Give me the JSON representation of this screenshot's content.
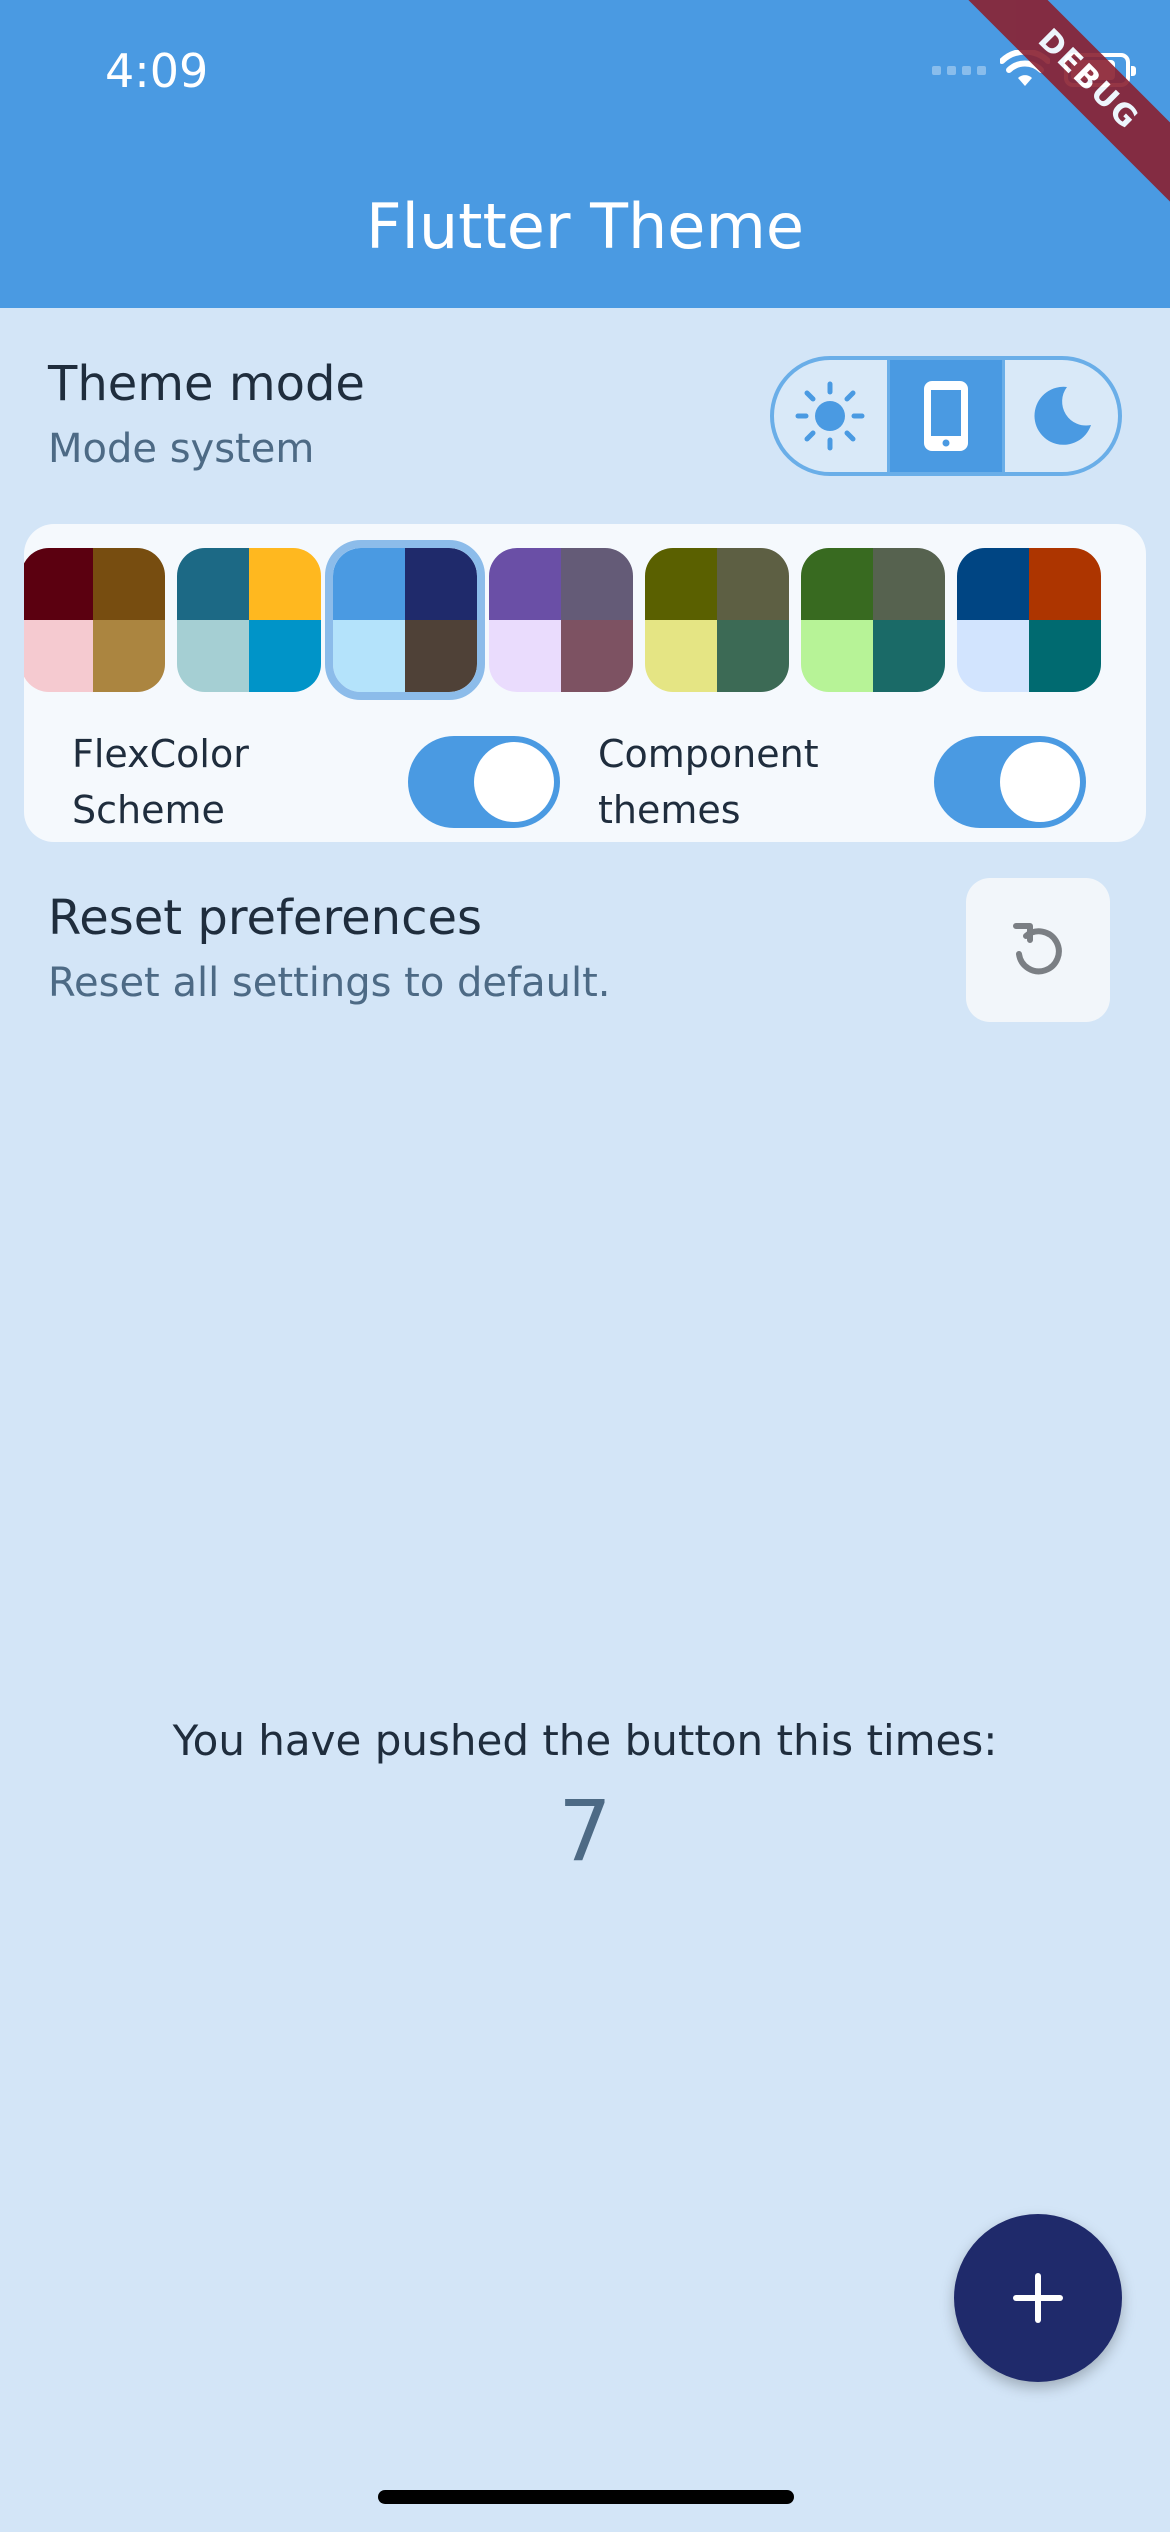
{
  "status_bar": {
    "time": "4:09",
    "debug_banner": "DEBUG"
  },
  "app_bar": {
    "title": "Flutter Theme",
    "color": "#4a9ae2"
  },
  "theme_mode": {
    "title": "Theme mode",
    "subtitle": "Mode system",
    "options": [
      {
        "icon": "sun-icon",
        "selected": false
      },
      {
        "icon": "phone-icon",
        "selected": true
      },
      {
        "icon": "moon-icon",
        "selected": false
      }
    ]
  },
  "schemes": [
    {
      "colors": [
        "#5b0010",
        "#774d10",
        "#f5cad0",
        "#ab8540"
      ],
      "selected": false
    },
    {
      "colors": [
        "#1c6985",
        "#ffb81f",
        "#a5cfd3",
        "#0094c8"
      ],
      "selected": false
    },
    {
      "colors": [
        "#4a9ae2",
        "#1f2a6b",
        "#b4e3fb",
        "#4f4137"
      ],
      "selected": true
    },
    {
      "colors": [
        "#6a4fa6",
        "#645b77",
        "#eadcfd",
        "#7d5262"
      ],
      "selected": false
    },
    {
      "colors": [
        "#5a6000",
        "#5d5f43",
        "#e5e584",
        "#3c6a55"
      ],
      "selected": false
    },
    {
      "colors": [
        "#386a20",
        "#56624f",
        "#b7f397",
        "#1a6a67"
      ],
      "selected": false
    },
    {
      "colors": [
        "#004583",
        "#ad3500",
        "#d2e4fe",
        "#006a70"
      ],
      "selected": false
    }
  ],
  "toggles": {
    "flexcolor_label_line1": "FlexColor",
    "flexcolor_label_line2": "Scheme",
    "flexcolor_on": true,
    "component_label_line1": "Component",
    "component_label_line2": "themes",
    "component_on": true
  },
  "reset": {
    "title": "Reset preferences",
    "subtitle": "Reset all settings to default.",
    "icon": "reset-icon"
  },
  "counter": {
    "label": "You have pushed the button this times:",
    "value": "7"
  },
  "fab": {
    "icon": "plus-icon",
    "color": "#1f2a6b"
  }
}
